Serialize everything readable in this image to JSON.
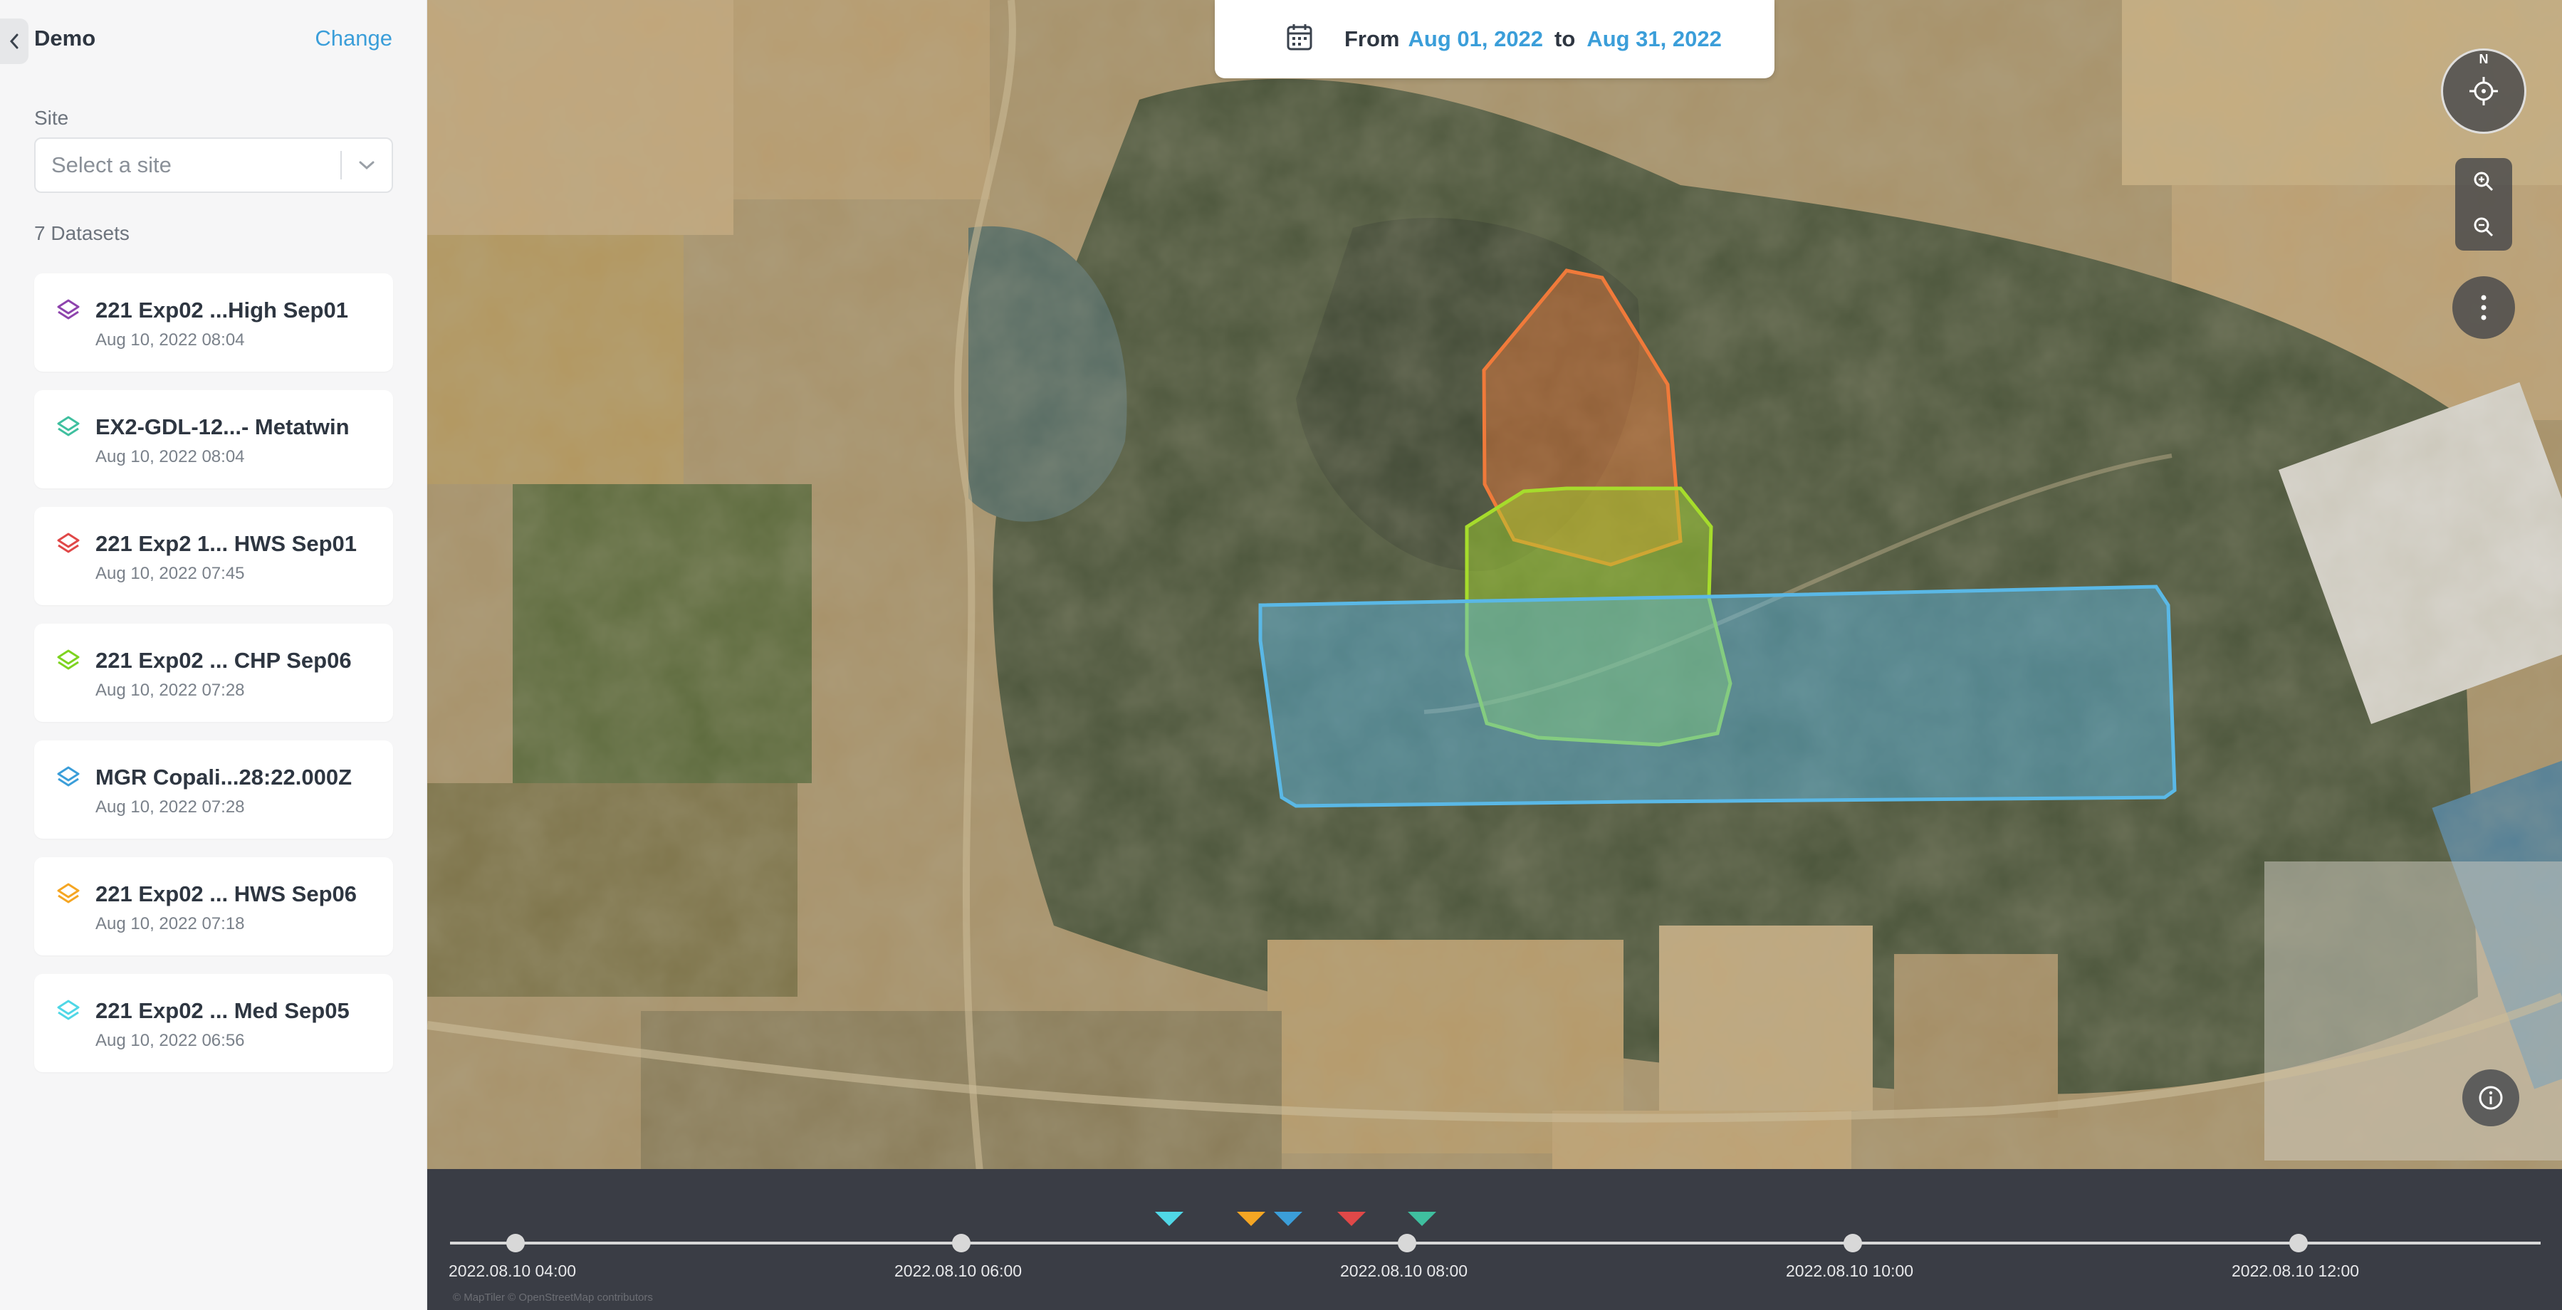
{
  "sidebar": {
    "title": "Demo",
    "change_label": "Change",
    "site_label": "Site",
    "site_placeholder": "Select a site",
    "datasets_count": "7 Datasets",
    "datasets": [
      {
        "name": "221 Exp02 ...High Sep01",
        "date": "Aug 10, 2022 08:04",
        "color": "#8e44ad"
      },
      {
        "name": "EX2-GDL-12...- Metatwin",
        "date": "Aug 10, 2022 08:04",
        "color": "#3fbf9f"
      },
      {
        "name": "221 Exp2 1... HWS Sep01",
        "date": "Aug 10, 2022 07:45",
        "color": "#e04848"
      },
      {
        "name": "221 Exp02 ... CHP Sep06",
        "date": "Aug 10, 2022 07:28",
        "color": "#7ed321"
      },
      {
        "name": "MGR Copali...28:22.000Z",
        "date": "Aug 10, 2022 07:28",
        "color": "#3b9ed9"
      },
      {
        "name": "221 Exp02 ... HWS Sep06",
        "date": "Aug 10, 2022 07:18",
        "color": "#f5a623"
      },
      {
        "name": "221 Exp02 ... Med Sep05",
        "date": "Aug 10, 2022 06:56",
        "color": "#50d7e6"
      }
    ]
  },
  "date_range": {
    "prefix": "From",
    "start": "Aug 01, 2022",
    "middle": "to",
    "end": "Aug 31, 2022"
  },
  "map_controls": {
    "compass_letter": "N"
  },
  "timeline": {
    "ticks": [
      "2022.08.10 04:00",
      "2022.08.10 06:00",
      "2022.08.10 08:00",
      "2022.08.10 10:00",
      "2022.08.10 12:00"
    ],
    "markers": [
      {
        "color": "#50d7e6",
        "time": "2022.08.10 06:56"
      },
      {
        "color": "#f5a623",
        "time": "2022.08.10 07:18"
      },
      {
        "color": "#3b9ed9",
        "time": "2022.08.10 07:28"
      },
      {
        "color": "#e04848",
        "time": "2022.08.10 07:45"
      },
      {
        "color": "#3fbf9f",
        "time": "2022.08.10 08:04"
      }
    ],
    "attribution": "© MapTiler © OpenStreetMap contributors"
  },
  "colors": {
    "accent": "#3b9ed9",
    "polygon_orange": "#f07a3a",
    "polygon_green": "#a6dc2c",
    "polygon_blue": "#5ab8e6"
  }
}
